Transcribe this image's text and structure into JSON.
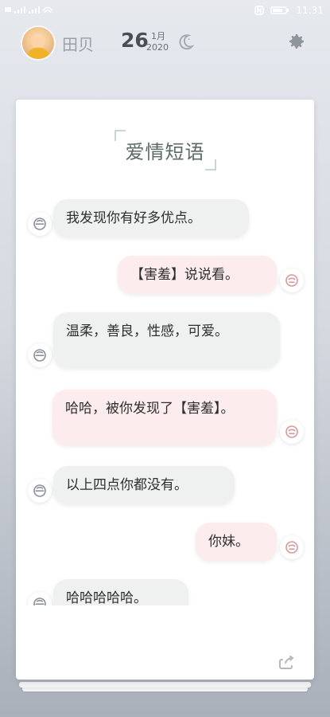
{
  "status_bar": {
    "left_text": "HD 4G 4G",
    "time": "11:31"
  },
  "header": {
    "username": "田贝",
    "date": {
      "day": "26",
      "month": "1月",
      "year": "2020"
    }
  },
  "card": {
    "title": "爱情短语",
    "messages": [
      {
        "side": "left",
        "text": "我发现你有好多优点。"
      },
      {
        "side": "right",
        "text": "【害羞】说说看。"
      },
      {
        "side": "left",
        "text": "温柔，善良，性感，可爱。"
      },
      {
        "side": "right",
        "text": "哈哈，被你发现了【害羞】。"
      },
      {
        "side": "left",
        "text": "以上四点你都没有。"
      },
      {
        "side": "right",
        "text": "你妹。"
      },
      {
        "side": "left",
        "text": "哈哈哈哈哈。"
      }
    ]
  },
  "colors": {
    "left_bubble": "#eef1f0",
    "right_bubble": "#fdeced",
    "title": "#5b6b66"
  }
}
